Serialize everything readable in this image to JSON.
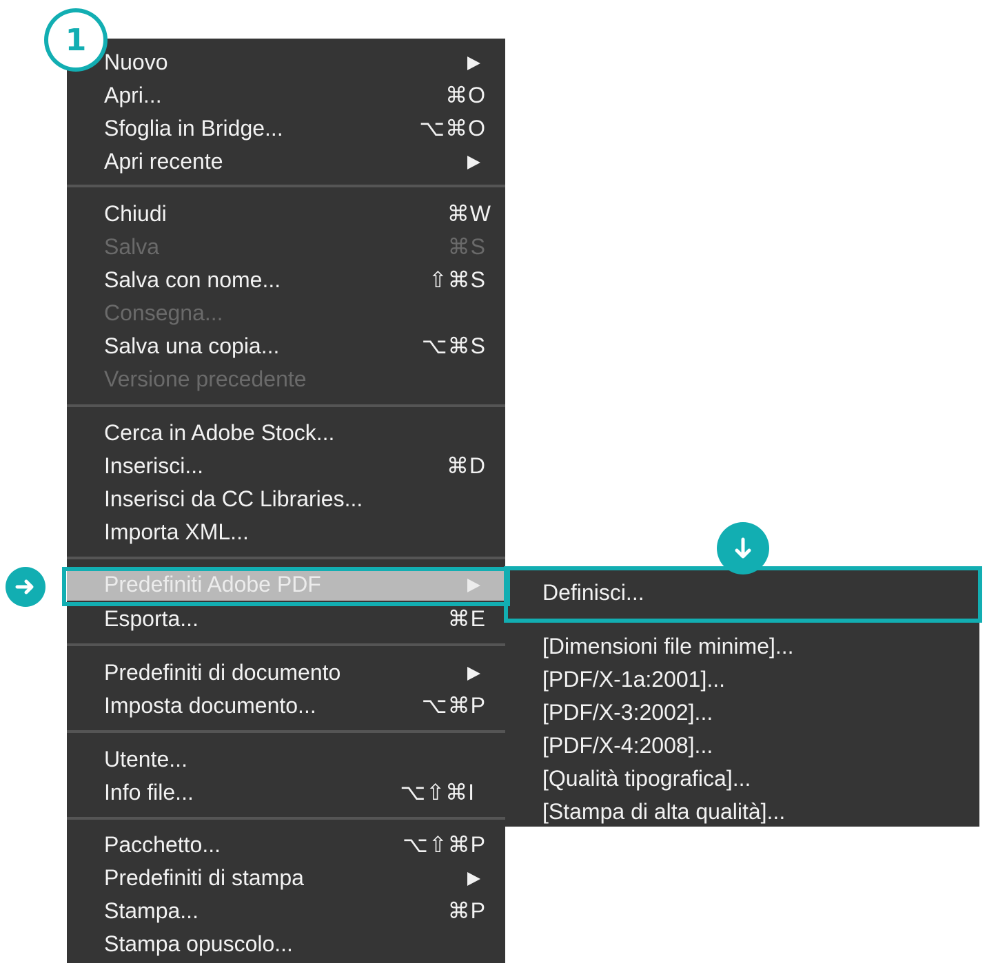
{
  "step_marker": "1",
  "menu": {
    "items": [
      {
        "label": "Nuovo",
        "shortcut": "",
        "submenu": true,
        "disabled": false
      },
      {
        "label": "Apri...",
        "shortcut": "⌘O",
        "submenu": false,
        "disabled": false
      },
      {
        "label": "Sfoglia in Bridge...",
        "shortcut": "⌥⌘O",
        "submenu": false,
        "disabled": false
      },
      {
        "label": "Apri recente",
        "shortcut": "",
        "submenu": true,
        "disabled": false
      },
      {
        "label": "Chiudi",
        "shortcut": "⌘W",
        "submenu": false,
        "disabled": false
      },
      {
        "label": "Salva",
        "shortcut": "⌘S",
        "submenu": false,
        "disabled": true
      },
      {
        "label": "Salva con nome...",
        "shortcut": "⇧⌘S",
        "submenu": false,
        "disabled": false
      },
      {
        "label": "Consegna...",
        "shortcut": "",
        "submenu": false,
        "disabled": true
      },
      {
        "label": "Salva una copia...",
        "shortcut": "⌥⌘S",
        "submenu": false,
        "disabled": false
      },
      {
        "label": "Versione precedente",
        "shortcut": "",
        "submenu": false,
        "disabled": true
      },
      {
        "label": "Cerca in Adobe Stock...",
        "shortcut": "",
        "submenu": false,
        "disabled": false
      },
      {
        "label": "Inserisci...",
        "shortcut": "⌘D",
        "submenu": false,
        "disabled": false
      },
      {
        "label": "Inserisci da CC Libraries...",
        "shortcut": "",
        "submenu": false,
        "disabled": false
      },
      {
        "label": "Importa XML...",
        "shortcut": "",
        "submenu": false,
        "disabled": false
      },
      {
        "label": "Predefiniti Adobe PDF",
        "shortcut": "",
        "submenu": true,
        "disabled": false,
        "highlighted": true
      },
      {
        "label": "Esporta...",
        "shortcut": "⌘E",
        "submenu": false,
        "disabled": false
      },
      {
        "label": "Predefiniti di documento",
        "shortcut": "",
        "submenu": true,
        "disabled": false
      },
      {
        "label": "Imposta documento...",
        "shortcut": "⌥⌘P",
        "submenu": false,
        "disabled": false
      },
      {
        "label": "Utente...",
        "shortcut": "",
        "submenu": false,
        "disabled": false
      },
      {
        "label": "Info file...",
        "shortcut": "⌥⇧⌘I",
        "submenu": false,
        "disabled": false
      },
      {
        "label": "Pacchetto...",
        "shortcut": "⌥⇧⌘P",
        "submenu": false,
        "disabled": false
      },
      {
        "label": "Predefiniti di stampa",
        "shortcut": "",
        "submenu": true,
        "disabled": false
      },
      {
        "label": "Stampa...",
        "shortcut": "⌘P",
        "submenu": false,
        "disabled": false
      },
      {
        "label": "Stampa opuscolo...",
        "shortcut": "",
        "submenu": false,
        "disabled": false
      }
    ]
  },
  "submenu": {
    "items": [
      {
        "label": "Definisci..."
      },
      {
        "label": "[Dimensioni file minime]..."
      },
      {
        "label": "[PDF/X-1a:2001]..."
      },
      {
        "label": "[PDF/X-3:2002]..."
      },
      {
        "label": "[PDF/X-4:2008]..."
      },
      {
        "label": "[Qualità tipografica]..."
      },
      {
        "label": "[Stampa di alta qualità]..."
      }
    ]
  },
  "colors": {
    "menu_background": "#353535",
    "accent": "#12aeb2",
    "text": "#f2f2f2",
    "disabled_text": "#6a6a6a",
    "highlight": "#b9b9b9"
  },
  "icons": {
    "submenu_indicator": "triangle-right",
    "pointer": "arrow-right",
    "download_hint": "arrow-down"
  }
}
